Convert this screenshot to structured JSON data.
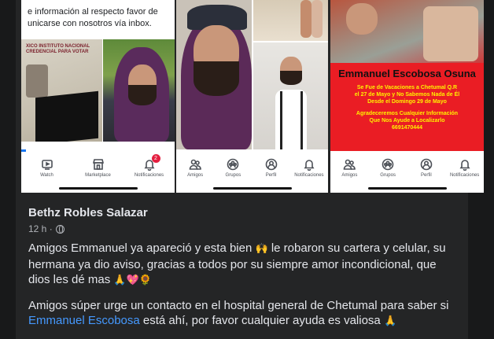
{
  "collage": {
    "panel1": {
      "message_line1": "e información al respecto favor de",
      "message_line2": "unicarse con nosotros vía inbox.",
      "id_card_text": "XICO   INSTITUTO NACIONAL  CREDENCIAL PARA VOTAR"
    },
    "panel3": {
      "flyer_name": "Emmanuel Escobosa Osuna",
      "flyer_line1": "Se Fue de Vacaciones a Chetumal Q.R",
      "flyer_line2": "el 27 de Mayo y No Sabemos Nada de Él",
      "flyer_line3": "Desde el Domingo 29 de Mayo",
      "flyer_line4": "Agradeceremos Cualquier Información",
      "flyer_line5": "Que Nos Ayude a Localizarlo",
      "flyer_phone": "6691470444"
    },
    "nav1": [
      {
        "label": "Watch",
        "icon": "watch-icon"
      },
      {
        "label": "Marketplace",
        "icon": "marketplace-icon"
      },
      {
        "label": "Notificaciones",
        "icon": "bell-icon",
        "badge": "2"
      }
    ],
    "nav2": [
      {
        "label": "Amigos",
        "icon": "friends-icon"
      },
      {
        "label": "Grupos",
        "icon": "groups-icon"
      },
      {
        "label": "Perfil",
        "icon": "profile-icon"
      },
      {
        "label": "Notificaciones",
        "icon": "bell-icon"
      }
    ],
    "nav3": [
      {
        "label": "Amigos",
        "icon": "friends-icon"
      },
      {
        "label": "Grupos",
        "icon": "groups-icon"
      },
      {
        "label": "Perfil",
        "icon": "profile-icon"
      },
      {
        "label": "Notificaciones",
        "icon": "bell-icon"
      }
    ]
  },
  "post": {
    "author": "Bethz Robles Salazar",
    "time": "12 h ·",
    "paragraph1_a": "Amigos Emmanuel ya apareció y esta bien ",
    "paragraph1_emoji": "🙌",
    "paragraph1_b": " le robaron su cartera y celular, su hermana ya dio aviso, gracias a todos por su siempre amor incondicional, que dios les dé mas ",
    "paragraph1_emojis_end": "🙏💖🌻",
    "paragraph2_a": "Amigos súper urge un contacto en el hospital general de Chetumal para saber si ",
    "paragraph2_mention": "Emmanuel Escobosa",
    "paragraph2_b": " está ahí, por favor cualquier ayuda es valiosa ",
    "paragraph2_emoji": "🙏"
  },
  "colors": {
    "background": "#18191a",
    "card": "#242526",
    "text_primary": "#e4e6eb",
    "text_secondary": "#b0b3b8",
    "link": "#4599ff",
    "flyer_red": "#ea1d24"
  }
}
